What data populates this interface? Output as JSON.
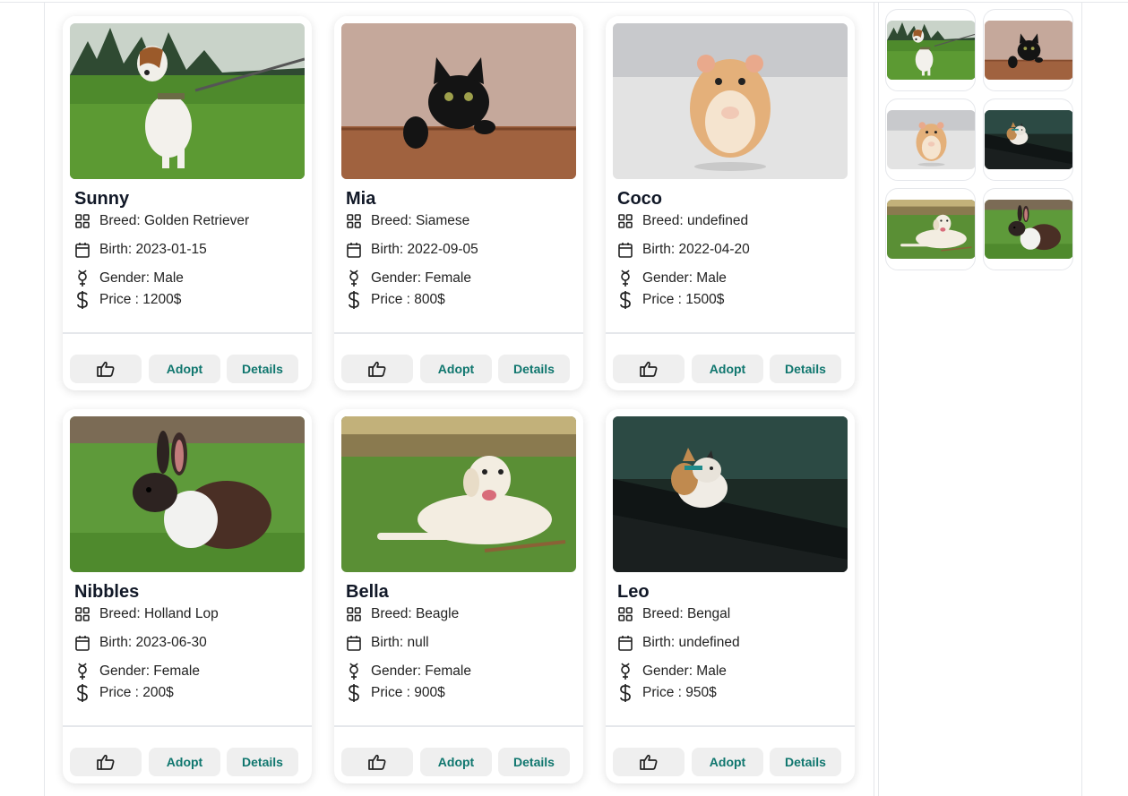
{
  "pets": [
    {
      "name": "Sunny",
      "breed": "Breed: Golden Retriever",
      "birth": "Birth: 2023-01-15",
      "gender": "Gender: Male",
      "price": "Price : 1200$",
      "photo": "dog-leash-photo"
    },
    {
      "name": "Mia",
      "breed": "Breed: Siamese",
      "birth": "Birth: 2022-09-05",
      "gender": "Gender: Female",
      "price": "Price : 800$",
      "photo": "black-cat-photo"
    },
    {
      "name": "Coco",
      "breed": "Breed: undefined",
      "birth": "Birth: 2022-04-20",
      "gender": "Gender: Male",
      "price": "Price : 1500$",
      "photo": "hamster-photo"
    },
    {
      "name": "Nibbles",
      "breed": "Breed: Holland Lop",
      "birth": "Birth: 2023-06-30",
      "gender": "Gender: Female",
      "price": "Price : 200$",
      "photo": "rabbit-photo"
    },
    {
      "name": "Bella",
      "breed": "Breed: Beagle",
      "birth": "Birth: null",
      "gender": "Gender: Female",
      "price": "Price : 900$",
      "photo": "white-dog-photo"
    },
    {
      "name": "Leo",
      "breed": "Breed: Bengal",
      "birth": "Birth: undefined",
      "gender": "Gender: Male",
      "price": "Price : 950$",
      "photo": "calico-cat-photo"
    }
  ],
  "buttons": {
    "adopt": "Adopt",
    "details": "Details",
    "like_icon": "thumbs-up-icon"
  },
  "icons": {
    "breed": "grid-icon",
    "birth": "calendar-icon",
    "gender": "gender-icon",
    "price": "dollar-icon"
  },
  "sidebar": {
    "thumbnails": [
      "dog-leash-photo",
      "black-cat-photo",
      "hamster-photo",
      "calico-cat-photo",
      "white-dog-photo",
      "rabbit-photo"
    ]
  },
  "colors": {
    "accent": "#0f766e",
    "button_bg": "#efefef"
  }
}
